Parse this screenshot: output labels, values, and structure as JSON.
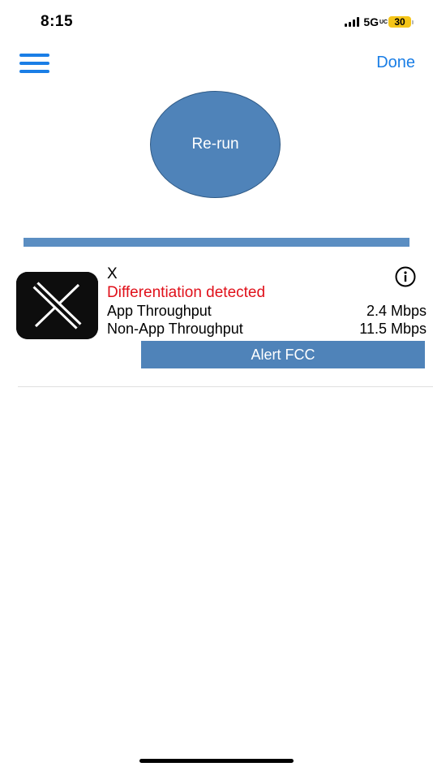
{
  "status_bar": {
    "time": "8:15",
    "network": "5G",
    "network_suffix": "UC",
    "battery": "30"
  },
  "nav": {
    "menu_icon": "hamburger-menu-icon",
    "done_label": "Done"
  },
  "rerun": {
    "label": "Re-run"
  },
  "progress": {
    "fraction": 1.0
  },
  "result": {
    "app_name": "X",
    "app_icon": "x-logo-icon",
    "status": "Differentiation detected",
    "app_throughput_label": "App Throughput",
    "app_throughput_value": "2.4 Mbps",
    "nonapp_throughput_label": "Non-App Throughput",
    "nonapp_throughput_value": "11.5 Mbps",
    "alert_label": "Alert FCC",
    "info_icon": "info-icon"
  },
  "colors": {
    "accent": "#1a7ee6",
    "button": "#4f83b9",
    "progress": "#5b8ec2",
    "alert_text": "#e0101a",
    "battery": "#f5c518"
  }
}
